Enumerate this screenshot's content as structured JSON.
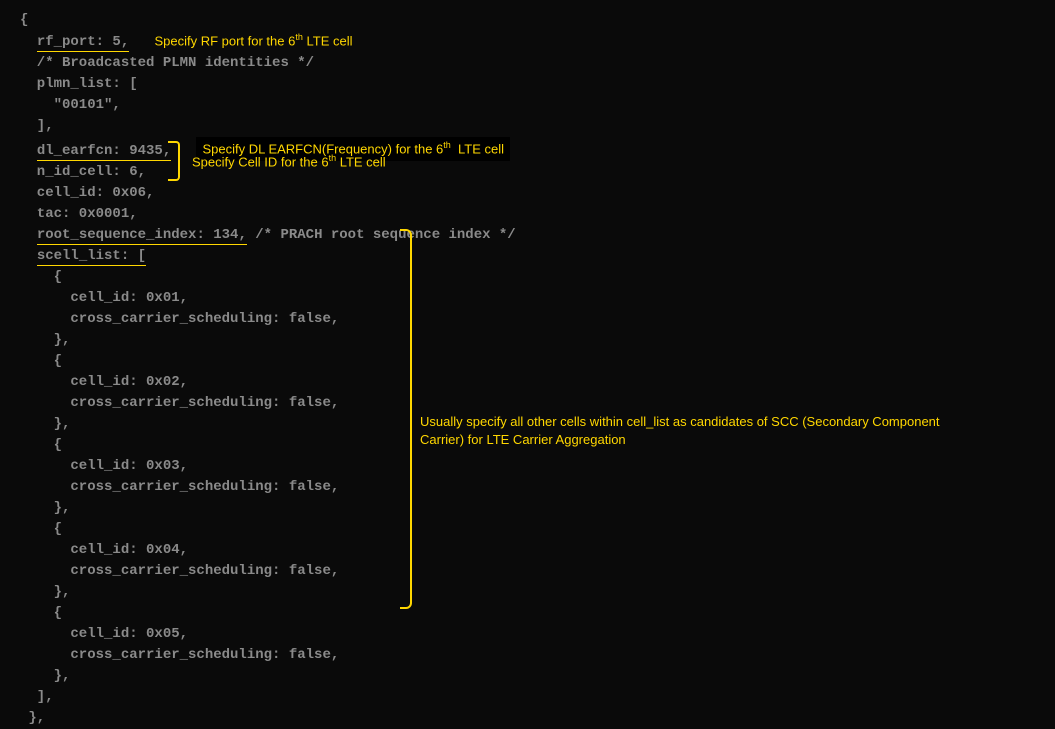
{
  "code": {
    "open_brace": "{",
    "rf_port": "  rf_port: 5,",
    "plmn_comment": "  /* Broadcasted PLMN identities */",
    "plmn_list_open": "  plmn_list: [",
    "plmn_value": "    \"00101\",",
    "plmn_list_close": "  ],",
    "dl_earfcn": "  dl_earfcn: 9435,",
    "n_id_cell": "  n_id_cell: 6,",
    "cell_id": "  cell_id: 0x06,",
    "tac": "  tac: 0x0001,",
    "root_seq": "  root_sequence_index: 134,",
    "root_seq_comment": " /* PRACH root sequence index */",
    "scell_list_open": "  scell_list: [",
    "scell_item_open": "    {",
    "scell_item_close": "    },",
    "scell_cid1": "      cell_id: 0x01,",
    "scell_ccs": "      cross_carrier_scheduling: false,",
    "scell_cid2": "      cell_id: 0x02,",
    "scell_cid3": "      cell_id: 0x03,",
    "scell_cid4": "      cell_id: 0x04,",
    "scell_cid5": "      cell_id: 0x05,",
    "scell_list_close": "  ],",
    "blank": "",
    "close_brace": " },"
  },
  "annotations": {
    "rf_port": "Specify RF port for the 6",
    "rf_port_suffix": " LTE cell",
    "dl_earfcn": "Specify DL EARFCN(Frequency) for the 6",
    "dl_earfcn_suffix": "  LTE cell",
    "cell_id": "Specify Cell ID for the 6",
    "cell_id_suffix": "  LTE cell",
    "scell": "Usually specify all other cells within cell_list as candidates of SCC (Secondary Component Carrier) for LTE Carrier Aggregation",
    "th": "th"
  }
}
